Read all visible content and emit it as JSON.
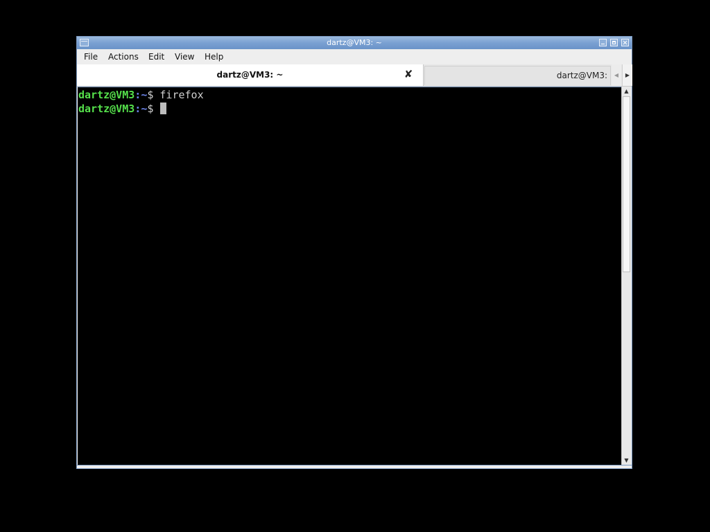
{
  "window": {
    "title": "dartz@VM3: ~"
  },
  "menu": {
    "items": [
      "File",
      "Actions",
      "Edit",
      "View",
      "Help"
    ]
  },
  "tabs": [
    {
      "label": "dartz@VM3: ~",
      "active": true,
      "close_icon": "close-icon"
    },
    {
      "label": "dartz@VM3:",
      "active": false
    }
  ],
  "terminal": {
    "lines": [
      {
        "user_host": "dartz@VM3",
        "sep": ":",
        "path": "~",
        "prompt": "$ ",
        "command": "firefox"
      },
      {
        "user_host": "dartz@VM3",
        "sep": ":",
        "path": "~",
        "prompt": "$ ",
        "command": ""
      }
    ],
    "colors": {
      "user_host": "#55e04b",
      "path": "#6a82e6",
      "text": "#d0d0d0",
      "background": "#000000"
    }
  },
  "icons": {
    "window_icon": "window-menu-icon",
    "minimize": "minimize-icon",
    "maximize": "maximize-icon",
    "close": "close-icon",
    "tab_scroll_left": "chevron-left-icon",
    "tab_scroll_right": "chevron-right-icon",
    "scroll_up": "arrow-up-icon",
    "scroll_down": "arrow-down-icon"
  }
}
